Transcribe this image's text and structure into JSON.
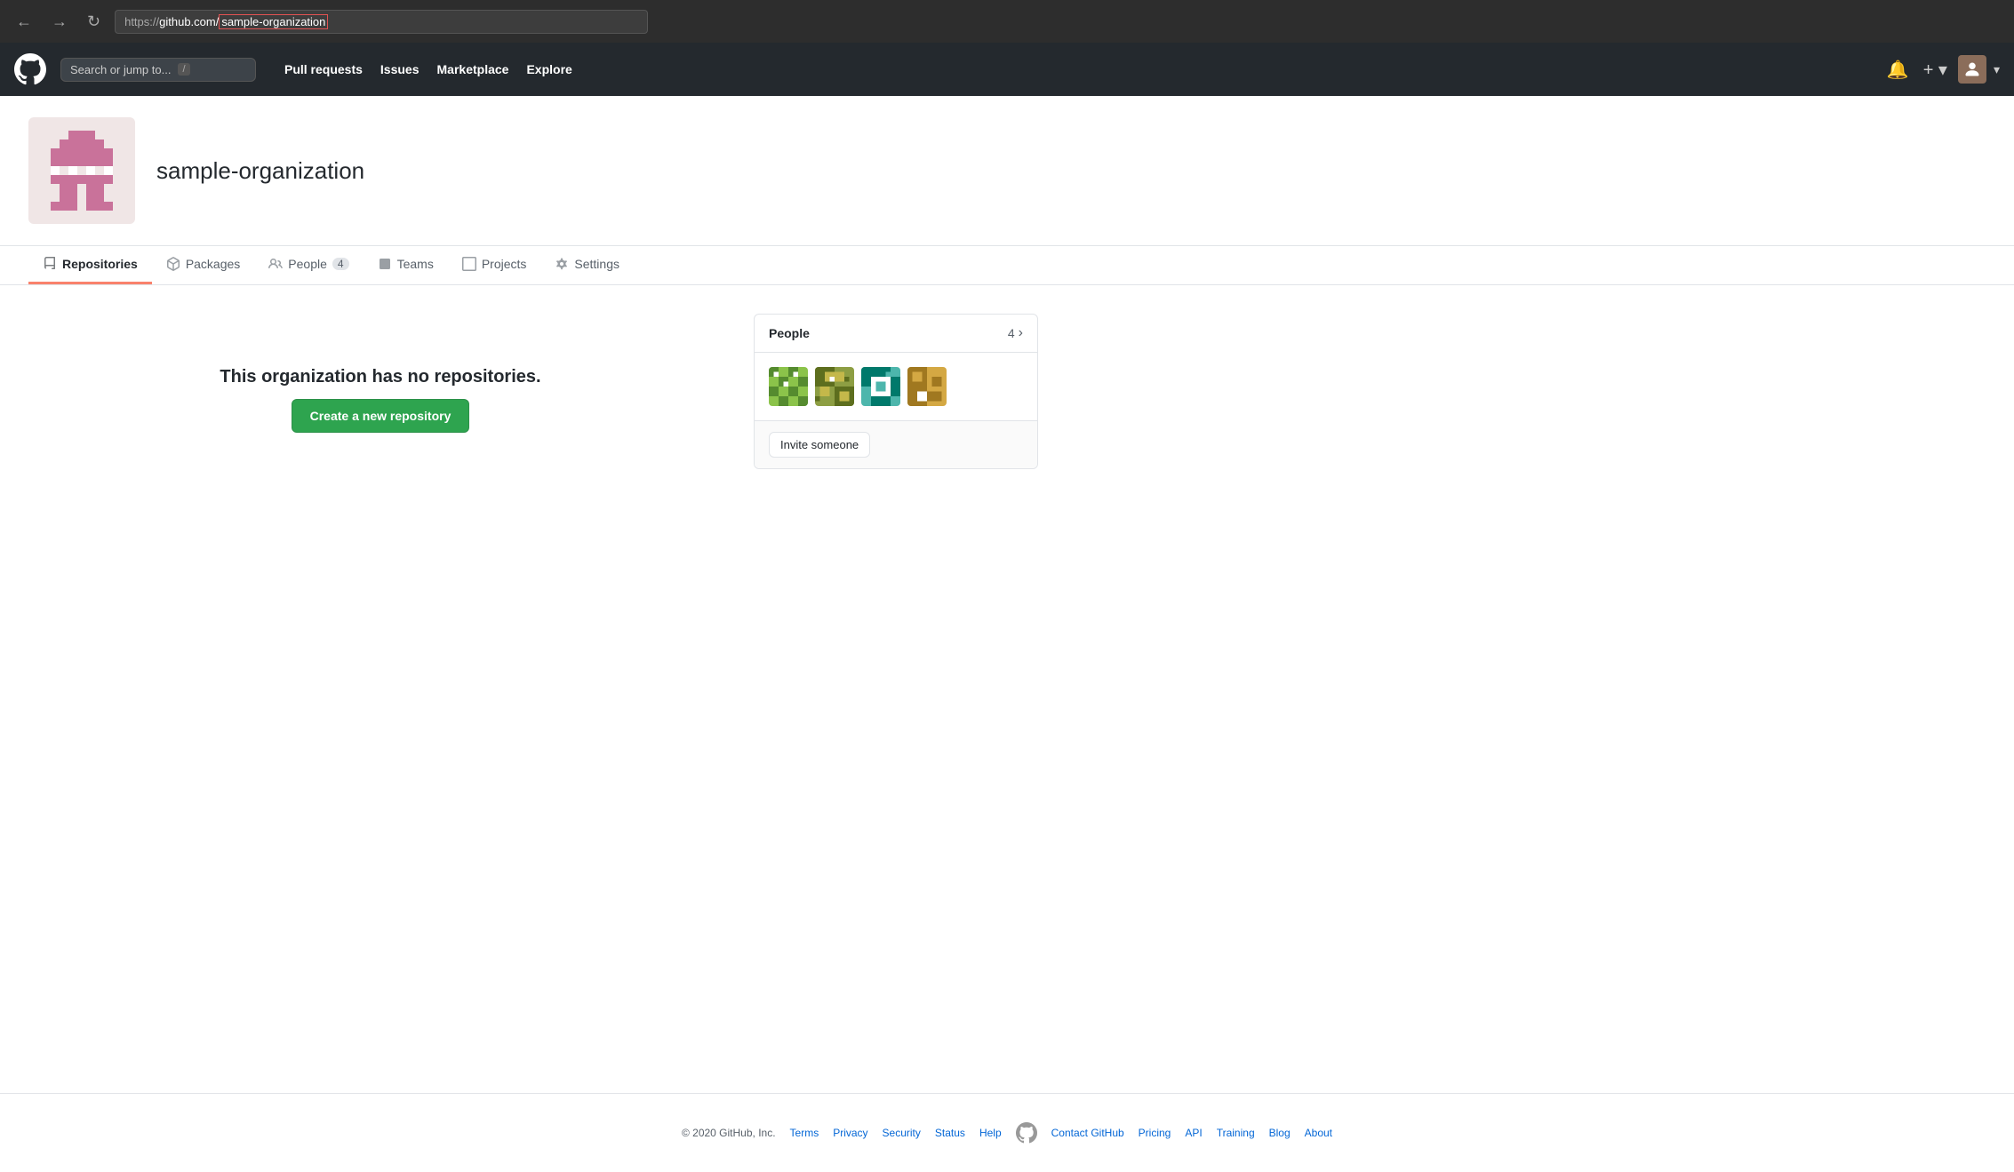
{
  "browser": {
    "back_btn": "←",
    "forward_btn": "→",
    "refresh_btn": "↻",
    "url_protocol": "https://",
    "url_domain": "github.com/",
    "url_highlight": "sample-organization"
  },
  "header": {
    "search_placeholder": "Search or jump to...",
    "search_kbd": "/",
    "nav": [
      {
        "label": "Pull requests",
        "id": "pull-requests"
      },
      {
        "label": "Issues",
        "id": "issues"
      },
      {
        "label": "Marketplace",
        "id": "marketplace"
      },
      {
        "label": "Explore",
        "id": "explore"
      }
    ],
    "notification_icon": "🔔",
    "add_icon": "+",
    "caret": "▾"
  },
  "org": {
    "name": "sample-organization"
  },
  "tabs": [
    {
      "label": "Repositories",
      "id": "repositories",
      "active": true,
      "count": null
    },
    {
      "label": "Packages",
      "id": "packages",
      "count": null
    },
    {
      "label": "People",
      "id": "people",
      "count": "4"
    },
    {
      "label": "Teams",
      "id": "teams",
      "count": null
    },
    {
      "label": "Projects",
      "id": "projects",
      "count": null
    },
    {
      "label": "Settings",
      "id": "settings",
      "count": null
    }
  ],
  "main": {
    "no_repos_message": "This organization has no repositories.",
    "create_repo_btn": "Create a new repository"
  },
  "sidebar": {
    "people_title": "People",
    "people_count": "4",
    "invite_btn": "Invite someone"
  },
  "footer": {
    "copyright": "© 2020 GitHub, Inc.",
    "links": [
      {
        "label": "Terms"
      },
      {
        "label": "Privacy"
      },
      {
        "label": "Security"
      },
      {
        "label": "Status"
      },
      {
        "label": "Help"
      },
      {
        "label": "Contact GitHub"
      },
      {
        "label": "Pricing"
      },
      {
        "label": "API"
      },
      {
        "label": "Training"
      },
      {
        "label": "Blog"
      },
      {
        "label": "About"
      }
    ]
  }
}
